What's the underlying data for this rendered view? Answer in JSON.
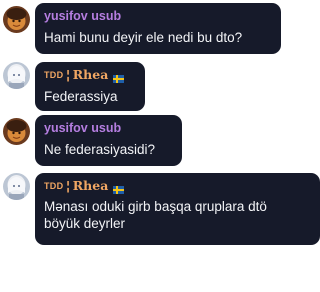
{
  "colors": {
    "bubble_bg": "#161a2a",
    "text": "#f3f4f7",
    "yusifov_name": "#b57ee0",
    "rhea_name": "#f0a663"
  },
  "messages": [
    {
      "author": "yusifov usub",
      "text": "Hami bunu deyir ele nedi bu dto?"
    },
    {
      "author_tag": "TDD",
      "author_sep": "¦",
      "author": "Rhea",
      "author_flag": "swedish-flag",
      "text": "Federassiya"
    },
    {
      "author": "yusifov usub",
      "text": "Ne federasiyasidi?"
    },
    {
      "author_tag": "TDD",
      "author_sep": "¦",
      "author": "Rhea",
      "author_flag": "swedish-flag",
      "text": "Mənası oduki girb başqa qruplara dtö böyük deyrler"
    }
  ]
}
